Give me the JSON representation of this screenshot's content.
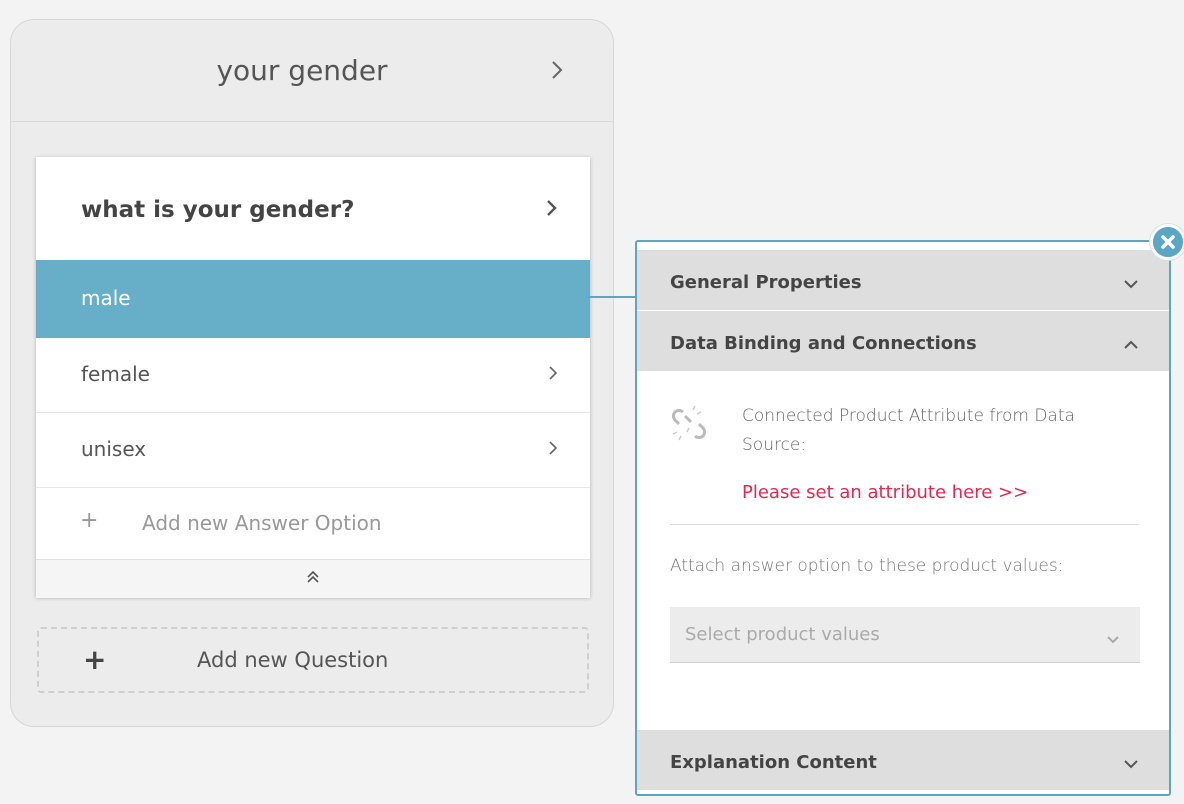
{
  "step": {
    "title": "your gender"
  },
  "question": {
    "title": "what is your gender?",
    "answers": [
      {
        "label": "male",
        "selected": true
      },
      {
        "label": "female",
        "selected": false
      },
      {
        "label": "unisex",
        "selected": false
      }
    ],
    "add_answer_label": "Add new Answer Option"
  },
  "add_question_label": "Add new Question",
  "panel": {
    "sections": {
      "general": "General Properties",
      "binding": "Data Binding and Connections",
      "explanation": "Explanation Content"
    },
    "binding": {
      "connected_text": "Connected Product Attribute from Data Source:",
      "set_attribute_link": "Please set an attribute here >>",
      "attach_label": "Attach answer option to these product values:",
      "select_placeholder": "Select product values"
    }
  },
  "colors": {
    "accent": "#5aa6c4",
    "selected_row": "#67afc9",
    "link_red": "#e8264d"
  }
}
